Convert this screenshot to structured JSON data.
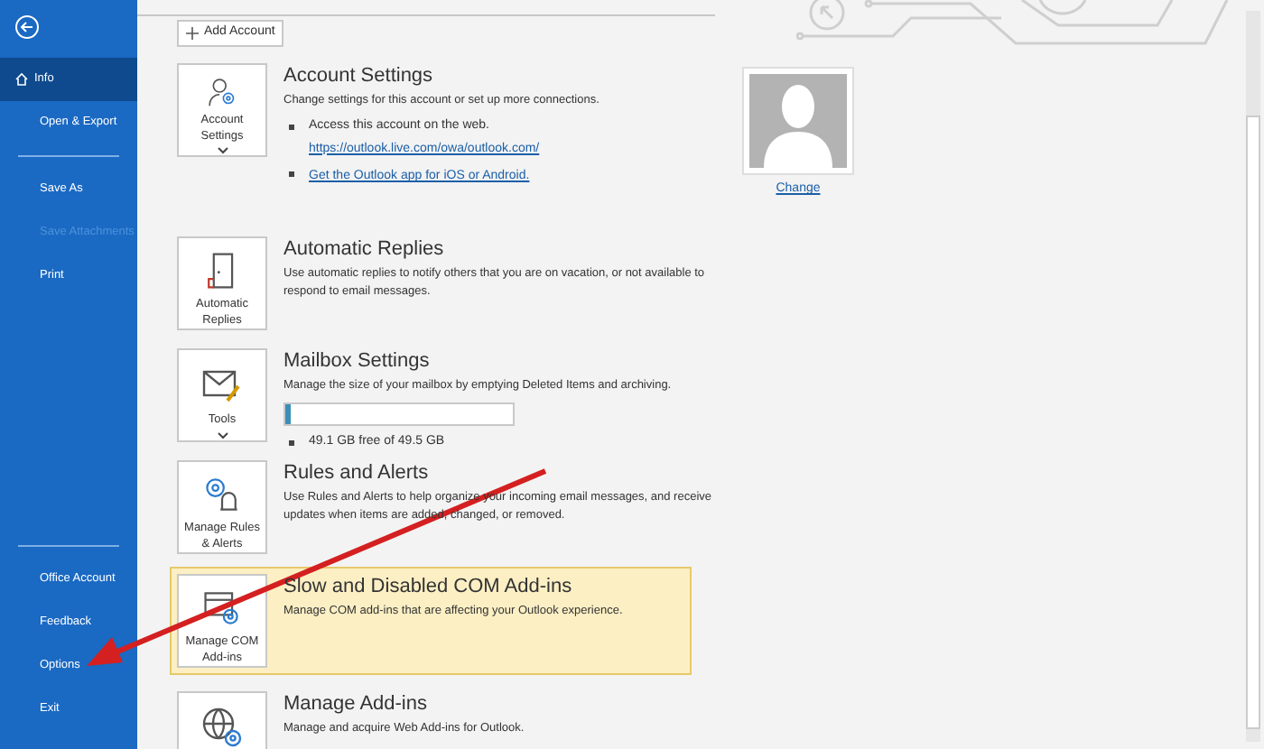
{
  "sidebar": {
    "items": [
      {
        "label": "Info",
        "selected": true,
        "disabled": false,
        "kind": "item"
      },
      {
        "label": "Open & Export",
        "selected": false,
        "disabled": false,
        "kind": "item"
      },
      {
        "kind": "divider"
      },
      {
        "label": "Save As",
        "selected": false,
        "disabled": false,
        "kind": "item"
      },
      {
        "label": "Save Attachments",
        "selected": false,
        "disabled": true,
        "kind": "item"
      },
      {
        "label": "Print",
        "selected": false,
        "disabled": false,
        "kind": "item"
      },
      {
        "kind": "spacer"
      },
      {
        "kind": "divider"
      },
      {
        "label": "Office Account",
        "selected": false,
        "disabled": false,
        "kind": "item"
      },
      {
        "label": "Feedback",
        "selected": false,
        "disabled": false,
        "kind": "item"
      },
      {
        "label": "Options",
        "selected": false,
        "disabled": false,
        "kind": "item"
      },
      {
        "label": "Exit",
        "selected": false,
        "disabled": false,
        "kind": "item"
      }
    ]
  },
  "add_account": "Add Account",
  "sections": [
    {
      "kind": "account",
      "tile": "Account Settings",
      "caret": true,
      "highlighted": false,
      "title": "Account Settings",
      "description": "Change settings for this account or set up more connections.",
      "bullets": [
        {
          "text": "Access this account on the web.",
          "link": "https://outlook.live.com/owa/outlook.com/"
        },
        {
          "link": "Get the Outlook app for iOS or Android."
        }
      ],
      "photo_link": "Change"
    },
    {
      "kind": "replies",
      "tile": "Automatic Replies",
      "caret": false,
      "highlighted": false,
      "title": "Automatic Replies",
      "description": "Use automatic replies to notify others that you are on vacation, or not available to respond to email messages."
    },
    {
      "kind": "tools",
      "tile": "Tools",
      "caret": true,
      "highlighted": false,
      "title": "Mailbox Settings",
      "description": "Manage the size of your mailbox by emptying Deleted Items and archiving.",
      "level": 0.02,
      "bullets": [
        {
          "text": "49.1 GB free of 49.5 GB"
        }
      ]
    },
    {
      "kind": "rules",
      "tile": "Manage Rules & Alerts",
      "caret": false,
      "highlighted": false,
      "title": "Rules and Alerts",
      "description": "Use Rules and Alerts to help organize your incoming email messages, and receive updates when items are added, changed, or removed."
    },
    {
      "kind": "com",
      "tile": "Manage COM Add-ins",
      "caret": false,
      "highlighted": true,
      "title": "Slow and Disabled COM Add-ins",
      "description": "Manage COM add-ins that are affecting your Outlook experience."
    },
    {
      "kind": "addins",
      "highlighted": false,
      "title": "Manage Add-ins",
      "description": "Manage and acquire Web Add-ins for Outlook."
    }
  ]
}
